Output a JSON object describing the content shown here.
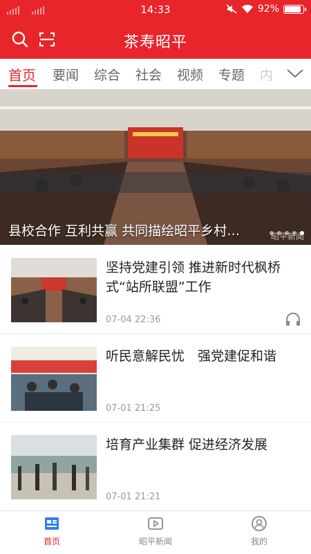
{
  "status_bar": {
    "time": "14:33",
    "battery": "92%",
    "battery_level": 0.92
  },
  "header": {
    "title": "茶寿昭平",
    "search_icon": "search-icon",
    "scan_icon": "scan-icon"
  },
  "tabs": [
    {
      "label": "首页",
      "active": true
    },
    {
      "label": "要闻"
    },
    {
      "label": "综合"
    },
    {
      "label": "社会"
    },
    {
      "label": "视频"
    },
    {
      "label": "专题"
    },
    {
      "label": "内"
    }
  ],
  "hero": {
    "caption": "县校合作 互利共赢 共同描绘昭平乡村…",
    "watermark": "昭平新闻",
    "slide_count": 5
  },
  "news": [
    {
      "title": "坚持党建引领 推进新时代枫桥式“站所联盟”工作",
      "time": "07-04 22:36",
      "has_audio": true
    },
    {
      "title": "听民意解民忧　强党建促和谐",
      "time": "07-01 21:25"
    },
    {
      "title": "培育产业集群 促进经济发展",
      "time": "07-01 21:21"
    }
  ],
  "bottom_nav": [
    {
      "label": "首页",
      "icon": "home-news-icon",
      "active": true
    },
    {
      "label": "昭平新闻",
      "icon": "video-play-icon"
    },
    {
      "label": "我的",
      "icon": "profile-icon"
    }
  ],
  "colors": {
    "brand": "#e8252a"
  }
}
